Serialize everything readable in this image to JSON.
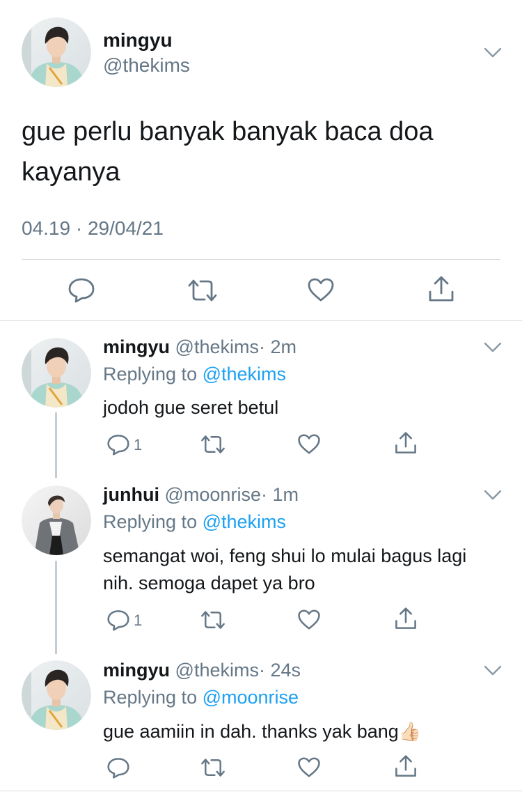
{
  "main_tweet": {
    "name": "mingyu",
    "handle": "@thekims",
    "text": "gue perlu banyak banyak baca doa kayanya",
    "timestamp": "04.19 · 29/04/21",
    "actions": [
      "reply-icon",
      "retweet-icon",
      "like-icon",
      "share-icon"
    ]
  },
  "replies": [
    {
      "name": "mingyu",
      "handle": "@thekims",
      "time": "· 2m",
      "replying_prefix": "Replying to ",
      "replying_to": "@thekims",
      "text": "jodoh gue seret betul",
      "reply_count": "1"
    },
    {
      "name": "junhui",
      "handle": "@moonrise",
      "time": "· 1m",
      "replying_prefix": "Replying to ",
      "replying_to": "@thekims",
      "text": "semangat woi, feng shui lo mulai bagus lagi nih. semoga dapet ya bro",
      "reply_count": "1"
    },
    {
      "name": "mingyu",
      "handle": "@thekims",
      "time": "· 24s",
      "replying_prefix": "Replying to ",
      "replying_to": "@moonrise",
      "text": "gue aamiin in dah. thanks yak bang",
      "emoji": "👍🏻"
    }
  ],
  "colors": {
    "link": "#1da1f2",
    "secondary": "#657786",
    "divider": "#d8dde1"
  }
}
